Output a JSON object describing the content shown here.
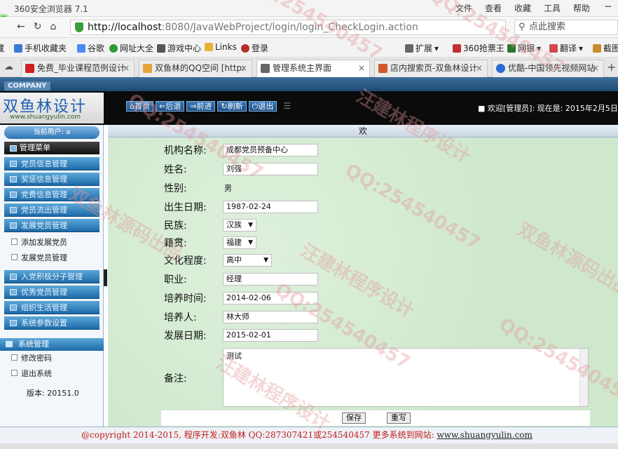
{
  "browser": {
    "title": "360安全浏览器 7.1",
    "menus": [
      "文件",
      "查看",
      "收藏",
      "工具",
      "帮助"
    ],
    "url_host": "http://localhost",
    "url_rest": ":8080/JavaWebProject/login/login_CheckLogin.action",
    "search_placeholder": "点此搜索",
    "bookmarks": [
      {
        "label": "藏",
        "color": "#888"
      },
      {
        "label": "手机收藏夹",
        "color": "#3a7bd5"
      },
      {
        "label": "谷歌",
        "color": "#4a8af4"
      },
      {
        "label": "网址大全",
        "color": "#2d9a3a"
      },
      {
        "label": "游戏中心",
        "color": "#555"
      },
      {
        "label": "Links",
        "color": "#e6b23a"
      },
      {
        "label": "登录",
        "color": "#b5322a"
      },
      {
        "label": "扩展",
        "color": "#666"
      },
      {
        "label": "360抢票王",
        "color": "#c23030"
      },
      {
        "label": "网银",
        "color": "#2a7a2a"
      },
      {
        "label": "翻译",
        "color": "#d24a4a"
      },
      {
        "label": "截图",
        "color": "#c98a2a"
      }
    ],
    "tabs": [
      {
        "label": "免费_毕业课程范例设计",
        "color": "#c22"
      },
      {
        "label": "双鱼林的QQ空间 [http:",
        "color": "#e6a23a"
      },
      {
        "label": "管理系统主界面",
        "color": "#666",
        "active": true
      },
      {
        "label": "店内搜索页-双鱼林设计",
        "color": "#d05a2a"
      },
      {
        "label": "优酷-中国领先视频网站",
        "color": "#2a6ad0"
      }
    ]
  },
  "header": {
    "company": "COMPANY",
    "brand": "双鱼林设计",
    "brand_url": "www.shuangyulin.com",
    "toolbar": [
      "首页",
      "后退",
      "前进",
      "刷新",
      "退出"
    ],
    "welcome": "■ 欢迎[管理员]:   现在是: 2015年2月5日"
  },
  "sidebar": {
    "current_user": "当前用户: a",
    "menu_title": "管理菜单",
    "items": [
      "党员信息管理",
      "奖惩信息管理",
      "党费信息管理",
      "党员流出管理",
      "发展党员管理"
    ],
    "sub_items": [
      "添加发展党员",
      "发展党员管理"
    ],
    "items2": [
      "入党积极分子管理",
      "优秀党员管理",
      "组织生活管理",
      "系统参数设置"
    ],
    "system_title": "系统管理",
    "system_items": [
      "修改密码",
      "退出系统"
    ],
    "version": "版本: 20151.0"
  },
  "main": {
    "title": "欢",
    "fields": [
      {
        "label": "机构名称:",
        "value": "成都党员预备中心",
        "type": "input"
      },
      {
        "label": "姓名:",
        "value": "刘强",
        "type": "input"
      },
      {
        "label": "性别:",
        "value": "男",
        "type": "plain"
      },
      {
        "label": "出生日期:",
        "value": "1987-02-24",
        "type": "input"
      },
      {
        "label": "民族:",
        "value": "汉族",
        "type": "select"
      },
      {
        "label": "籍贯:",
        "value": "福建",
        "type": "select"
      },
      {
        "label": "文化程度:",
        "value": "高中",
        "type": "select"
      },
      {
        "label": "职业:",
        "value": "经理",
        "type": "input"
      },
      {
        "label": "培养时间:",
        "value": "2014-02-06",
        "type": "input"
      },
      {
        "label": "培养人:",
        "value": "林大师",
        "type": "input"
      },
      {
        "label": "发展日期:",
        "value": "2015-02-01",
        "type": "input"
      }
    ],
    "remark_label": "备注:",
    "remark_value": "测试",
    "save_label": "保存",
    "reset_label": "重写"
  },
  "footer": {
    "text": "@copyright 2014-2015, 程序开发:双鱼林  QQ:287307421或254540457  更多系统到网站: ",
    "link": "www.shuangyulin.com"
  },
  "watermark": [
    "QQ:254540457",
    "汪建林程序设计",
    "双鱼林源码出品"
  ]
}
